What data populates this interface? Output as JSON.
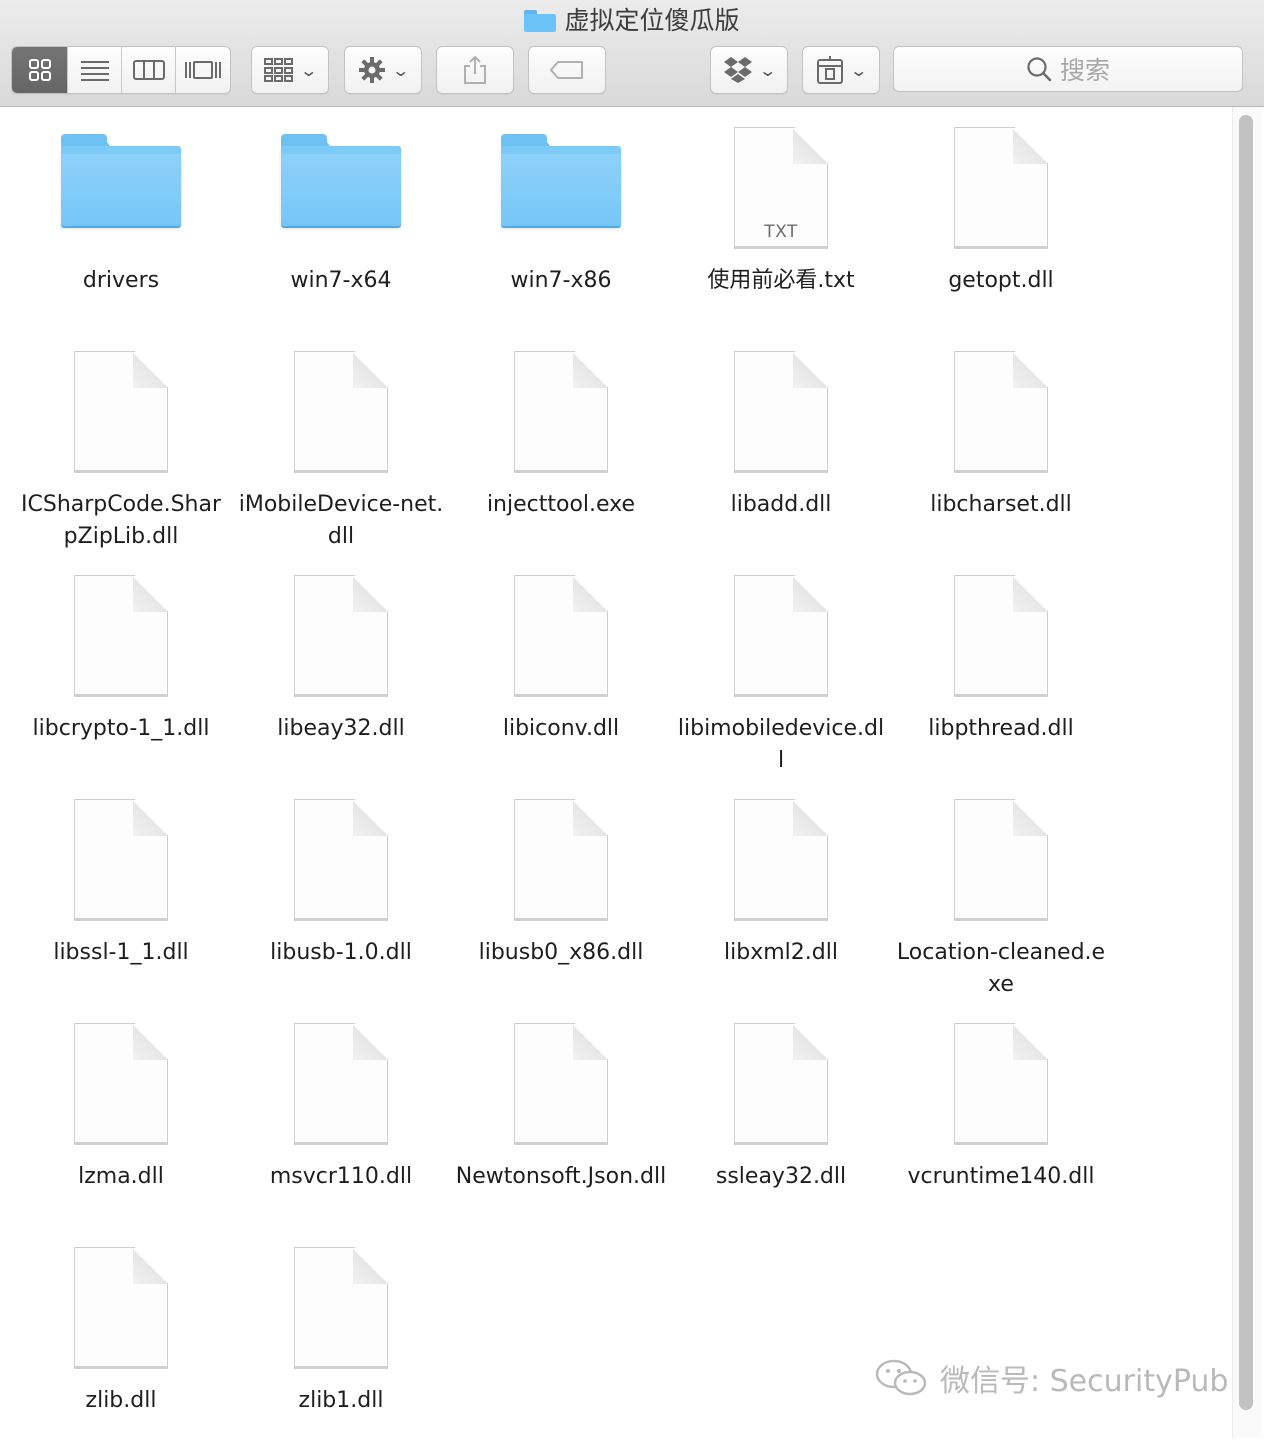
{
  "window": {
    "title": "虚拟定位傻瓜版",
    "title_icon": "folder-icon"
  },
  "toolbar": {
    "view_modes": [
      "icon-view",
      "list-view",
      "column-view",
      "cover-flow-view"
    ],
    "active_view": "icon-view",
    "arrange_icon": "arrange-icon",
    "action_icon": "gear-icon",
    "share_icon": "share-icon",
    "tags_icon": "tag-icon",
    "dropbox_icon": "dropbox-icon",
    "archive_icon": "archive-icon",
    "search_placeholder": "搜索"
  },
  "files": [
    {
      "name": "drivers",
      "kind": "folder"
    },
    {
      "name": "win7-x64",
      "kind": "folder"
    },
    {
      "name": "win7-x86",
      "kind": "folder"
    },
    {
      "name": "使用前必看.txt",
      "kind": "txt",
      "tag": "TXT"
    },
    {
      "name": "getopt.dll",
      "kind": "file"
    },
    {
      "name": "ICSharpCode.SharpZipLib.dll",
      "kind": "file"
    },
    {
      "name": "iMobileDevice-net.dll",
      "kind": "file"
    },
    {
      "name": "injecttool.exe",
      "kind": "file"
    },
    {
      "name": "libadd.dll",
      "kind": "file"
    },
    {
      "name": "libcharset.dll",
      "kind": "file"
    },
    {
      "name": "libcrypto-1_1.dll",
      "kind": "file"
    },
    {
      "name": "libeay32.dll",
      "kind": "file"
    },
    {
      "name": "libiconv.dll",
      "kind": "file"
    },
    {
      "name": "libimobiledevice.dll",
      "kind": "file"
    },
    {
      "name": "libpthread.dll",
      "kind": "file"
    },
    {
      "name": "libssl-1_1.dll",
      "kind": "file"
    },
    {
      "name": "libusb-1.0.dll",
      "kind": "file"
    },
    {
      "name": "libusb0_x86.dll",
      "kind": "file"
    },
    {
      "name": "libxml2.dll",
      "kind": "file"
    },
    {
      "name": "Location-cleaned.exe",
      "kind": "file"
    },
    {
      "name": "lzma.dll",
      "kind": "file"
    },
    {
      "name": "msvcr110.dll",
      "kind": "file"
    },
    {
      "name": "Newtonsoft.Json.dll",
      "kind": "file"
    },
    {
      "name": "ssleay32.dll",
      "kind": "file"
    },
    {
      "name": "vcruntime140.dll",
      "kind": "file"
    },
    {
      "name": "zlib.dll",
      "kind": "file"
    },
    {
      "name": "zlib1.dll",
      "kind": "file"
    }
  ],
  "watermark": {
    "text": "微信号: SecurityPub",
    "icon": "wechat-icon"
  }
}
